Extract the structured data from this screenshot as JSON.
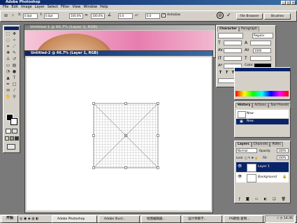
{
  "app": {
    "title": "Adobe Photoshop",
    "menu": [
      "File",
      "Edit",
      "Image",
      "Layer",
      "Select",
      "Filter",
      "View",
      "Window",
      "Help"
    ]
  },
  "options_bar": {
    "field1": "0.0pt",
    "field2": "0.0pt",
    "field3": "0.0pt",
    "field4": "0.0pt",
    "field5": "100.0%",
    "field6": "100.0%",
    "field7": "0.0",
    "field8": "0.0",
    "antialias_label": "Antialias",
    "tab_file_browser": "File Browser",
    "tab_brushes": "Brushes"
  },
  "documents": {
    "back_title": "Untitled-1 @ 66.7% (Layer 1, RGB)",
    "front_title": "Untitled-2 @ 66.7% (Layer 1, RGB)"
  },
  "character_panel": {
    "tab_character": "Character",
    "tab_paragraph": "Paragraph",
    "font_style": "Regular",
    "size_value": "1000",
    "color_label": "Color:"
  },
  "history_panel": {
    "tab_history": "History",
    "tab_actions": "Actions",
    "tab_tool_presets": "Tool Presets",
    "item_new": "New"
  },
  "layers_panel": {
    "tab_layers": "Layers",
    "tab_channels": "Channels",
    "tab_paths": "Paths",
    "blend_mode": "Normal",
    "opacity_label": "Opacity:",
    "opacity_value": "100%",
    "lock_label": "Lock:",
    "fill_label": "Fill:",
    "fill_value": "100%",
    "layer1": "Layer 1",
    "background": "Background"
  },
  "taskbar": {
    "start_label": "开始",
    "tasks": [
      "Adobe Photoshop",
      "Adobe Illust...",
      "绘图编辑器...",
      "设计师教学...",
      "PS教程-复制..."
    ],
    "clock": "14:36"
  }
}
